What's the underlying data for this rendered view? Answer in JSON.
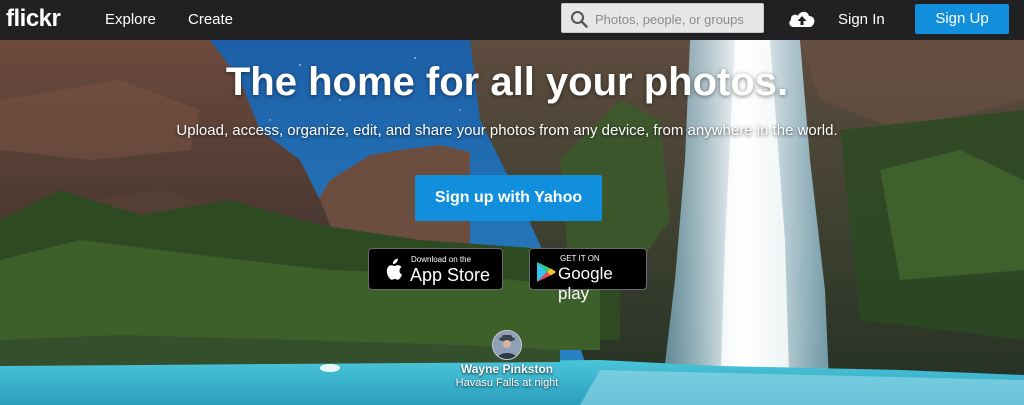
{
  "nav": {
    "logo": "flickr",
    "links": [
      "Explore",
      "Create"
    ],
    "search_placeholder": "Photos, people, or groups",
    "search_icon": "search-icon",
    "upload_icon": "cloud-upload-icon",
    "signin": "Sign In",
    "signup": "Sign Up"
  },
  "hero": {
    "headline": "The home for all your photos.",
    "subline": "Upload, access, organize, edit, and share your photos from any device, from anywhere in the world.",
    "cta": "Sign up with Yahoo",
    "app_store": {
      "small": "Download on the",
      "big": "App Store",
      "icon": "apple-icon"
    },
    "google_play": {
      "small": "GET IT ON",
      "big": "Google play",
      "icon": "google-play-icon"
    },
    "credit": {
      "name": "Wayne Pinkston",
      "title": "Havasu Falls at night"
    }
  },
  "colors": {
    "brand_blue": "#128fdc",
    "nav_bg": "#212124",
    "water": "#35b8cf"
  }
}
